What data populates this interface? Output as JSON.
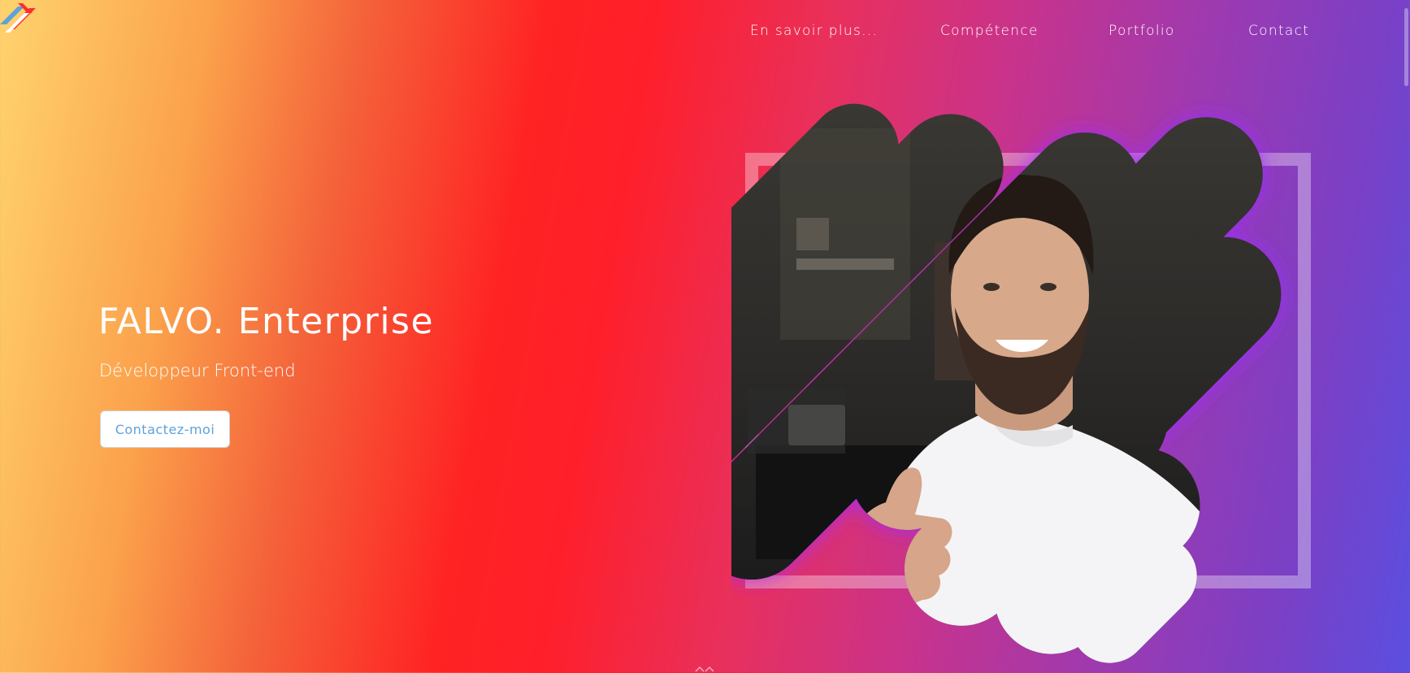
{
  "brand": {
    "logo_icon": "falvo-logo-icon",
    "colors": [
      "#5da2d9",
      "#ff2d2d",
      "#ffffff"
    ]
  },
  "nav": {
    "items": [
      {
        "label": "En savoir plus..."
      },
      {
        "label": "Compétence"
      },
      {
        "label": "Portfolio"
      },
      {
        "label": "Contact"
      }
    ]
  },
  "hero": {
    "title": "FALVO. Enterprise",
    "subtitle": "Développeur Front-end",
    "cta_label": "Contactez-moi",
    "portrait_icon": "profile-photo"
  },
  "theme": {
    "gradient": [
      "#ffd36e",
      "#f4623a",
      "#ff2323",
      "#c8338c",
      "#5b4fe0"
    ],
    "accent": "#5da2d9",
    "portrait_glow": "#a02cff"
  }
}
